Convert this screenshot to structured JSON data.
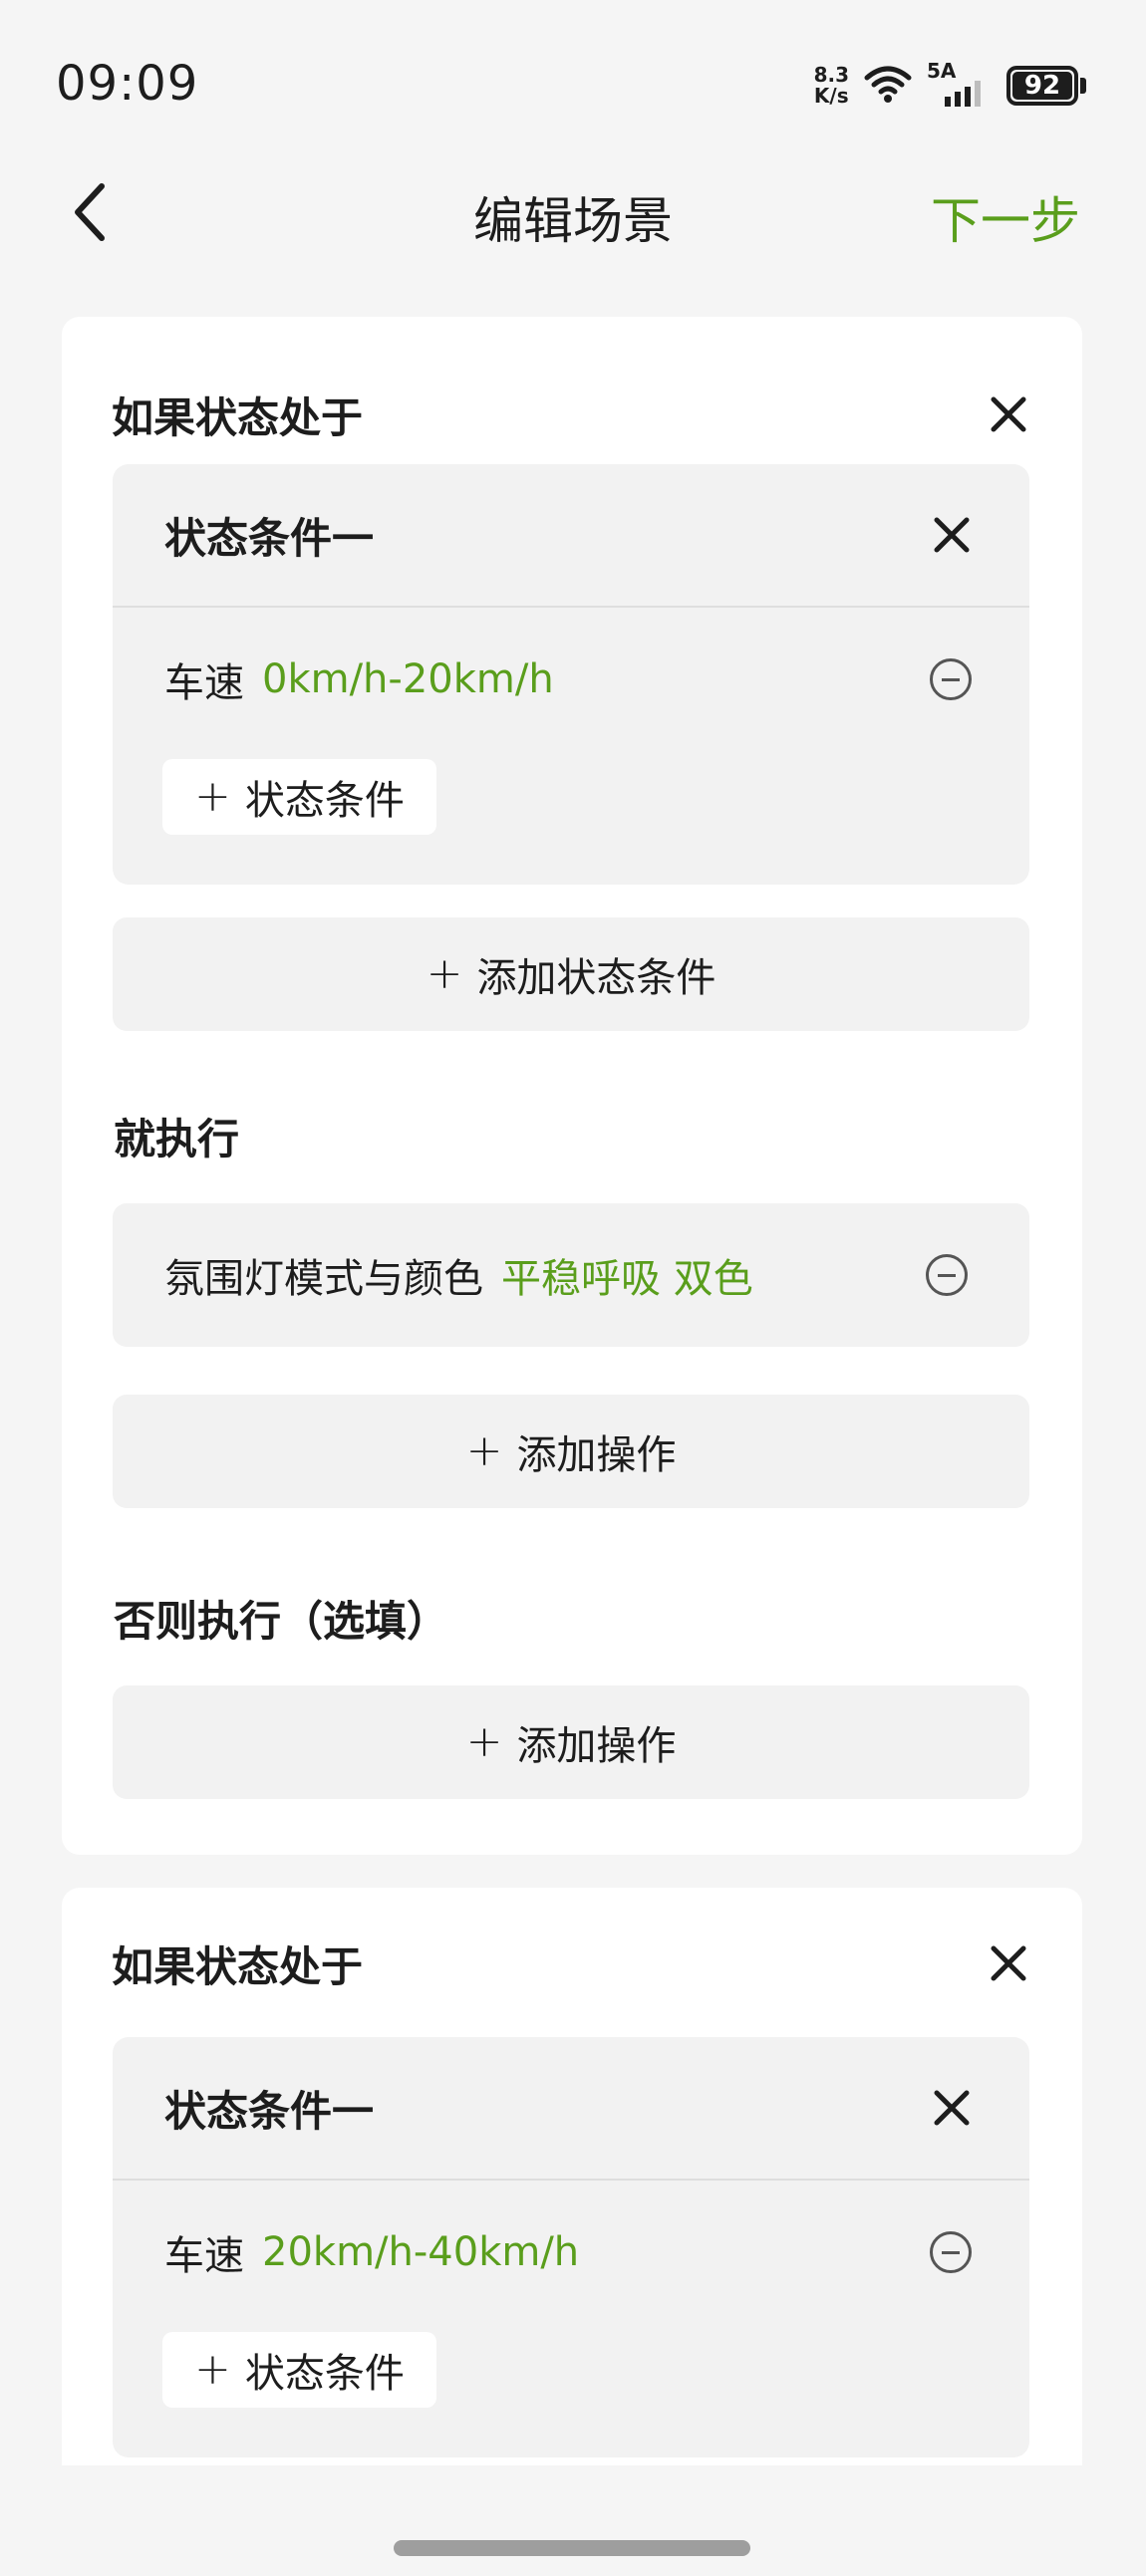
{
  "status_bar": {
    "time": "09:09",
    "net_speed_value": "8.3",
    "net_speed_unit": "K/s",
    "signal_label": "5A",
    "battery": "92"
  },
  "header": {
    "title": "编辑场景",
    "next_label": "下一步"
  },
  "blocks": [
    {
      "if_title": "如果状态处于",
      "condition_group_title": "状态条件一",
      "condition": {
        "name": "车速",
        "value": "0km/h-20km/h"
      },
      "add_condition_chip": "状态条件",
      "add_condition_group": "添加状态条件",
      "then_title": "就执行",
      "action": {
        "name": "氛围灯模式与颜色",
        "value": "平稳呼吸 双色"
      },
      "add_action": "添加操作",
      "else_title": "否则执行（选填）",
      "else_add_action": "添加操作"
    },
    {
      "if_title": "如果状态处于",
      "condition_group_title": "状态条件一",
      "condition": {
        "name": "车速",
        "value": "20km/h-40km/h"
      },
      "add_condition_chip": "状态条件"
    }
  ],
  "colors": {
    "accent": "#5a9e1c",
    "background": "#f5f5f5",
    "card": "#ffffff",
    "panel": "#f2f2f2"
  },
  "icons": [
    "back-arrow-icon",
    "close-icon",
    "minus-circle-icon",
    "plus-icon",
    "wifi-icon",
    "signal-icon",
    "battery-icon"
  ]
}
